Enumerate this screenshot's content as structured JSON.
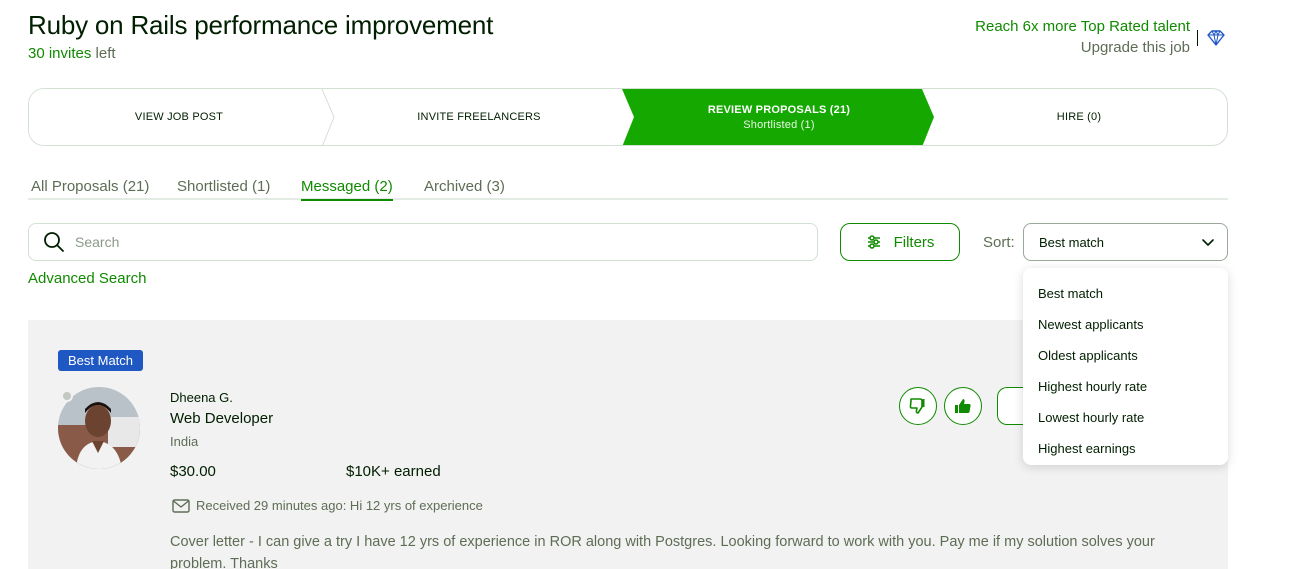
{
  "job": {
    "title": "Ruby on Rails performance improvement",
    "invites_count": "30 invites",
    "invites_rest": " left"
  },
  "upsell": {
    "reach": "Reach 6x more Top Rated talent",
    "upgrade": "Upgrade this job"
  },
  "stepper": {
    "steps": [
      {
        "label": "VIEW JOB POST",
        "sub": ""
      },
      {
        "label": "INVITE FREELANCERS",
        "sub": ""
      },
      {
        "label": "REVIEW PROPOSALS (21)",
        "sub": "Shortlisted (1)"
      },
      {
        "label": "HIRE (0)",
        "sub": ""
      }
    ],
    "active_color": "#14a800"
  },
  "tabs": [
    {
      "label": "All Proposals (21)"
    },
    {
      "label": "Shortlisted (1)"
    },
    {
      "label": "Messaged (2)"
    },
    {
      "label": "Archived (3)"
    }
  ],
  "search": {
    "placeholder": "Search",
    "advanced": "Advanced Search"
  },
  "filters": {
    "label": "Filters"
  },
  "sort": {
    "label": "Sort:",
    "selected": "Best match",
    "options": [
      "Best match",
      "Newest applicants",
      "Oldest applicants",
      "Highest hourly rate",
      "Lowest hourly rate",
      "Highest earnings"
    ]
  },
  "proposal": {
    "badge": "Best Match",
    "name": "Dheena G.",
    "title": "Web Developer",
    "country": "India",
    "rate": "$30.00",
    "earned": "$10K+ earned",
    "received": "Received 29 minutes ago: Hi 12 yrs of experience",
    "cover_letter": "Cover letter - I can give a try I have 12 yrs of experience in ROR along with Postgres. Looking forward to work with you. Pay me if my solution solves your problem. Thanks"
  },
  "colors": {
    "brand_green": "#108a00",
    "badge_blue": "#1f57c3",
    "card_bg": "#f2f2f2"
  }
}
